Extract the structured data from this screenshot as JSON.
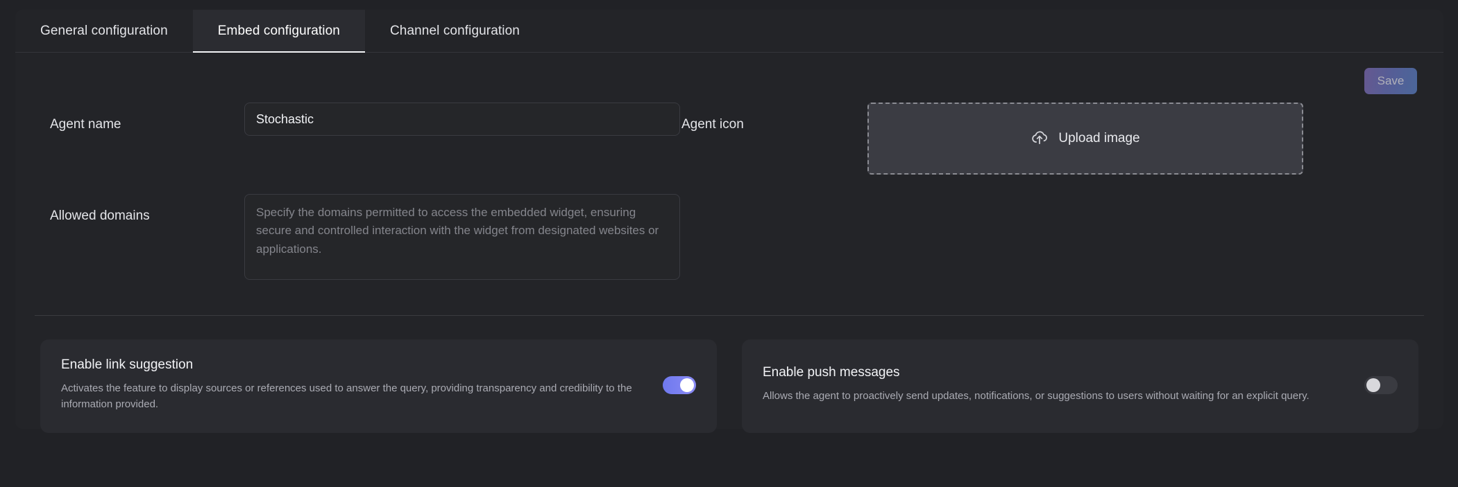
{
  "tabs": [
    {
      "label": "General configuration",
      "active": false
    },
    {
      "label": "Embed configuration",
      "active": true
    },
    {
      "label": "Channel configuration",
      "active": false
    }
  ],
  "toolbar": {
    "save_label": "Save"
  },
  "form": {
    "agent_name": {
      "label": "Agent name",
      "value": "Stochastic",
      "placeholder": ""
    },
    "agent_icon": {
      "label": "Agent icon",
      "upload_label": "Upload image",
      "icon": "cloud-upload-icon"
    },
    "allowed_domains": {
      "label": "Allowed domains",
      "value": "",
      "placeholder": "Specify the domains permitted to access the embedded widget, ensuring secure and controlled interaction with the widget from designated websites or applications."
    }
  },
  "cards": [
    {
      "title": "Enable link suggestion",
      "description": "Activates the feature to display sources or references used to answer the query, providing transparency and credibility to the information provided.",
      "enabled": true
    },
    {
      "title": "Enable push messages",
      "description": "Allows the agent to proactively send updates, notifications, or suggestions to users without waiting for an explicit query.",
      "enabled": false
    }
  ],
  "colors": {
    "page_background": "#212226",
    "panel_background": "#232428",
    "accent_toggle_on": "#7b7bf0",
    "save_gradient_start": "#6a5b96",
    "save_gradient_end": "#4d6aa0",
    "card_background": "#2a2b30",
    "upload_background": "#3b3c43"
  }
}
